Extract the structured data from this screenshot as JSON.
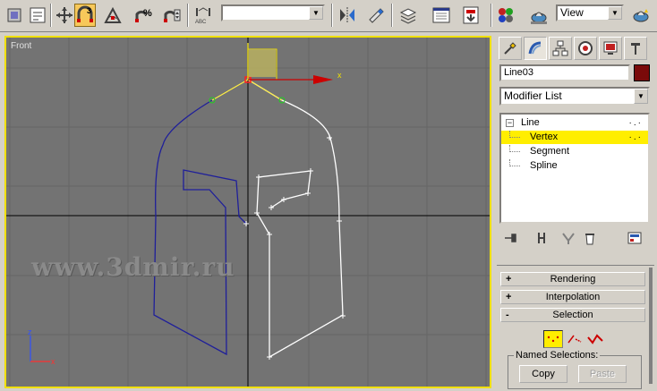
{
  "toolbar": {
    "named_selection_value": "",
    "view_dropdown_value": "View",
    "snap_label": "3",
    "angle_snap_label": "%",
    "mirror_label": "ABC"
  },
  "viewport": {
    "label": "Front",
    "axis_x_label": "x",
    "gizmo_x_label": "x",
    "gizmo_z_label": "z",
    "watermark": "www.3dmir.ru",
    "border_color": "#f0e000",
    "background_color": "#737373"
  },
  "panel": {
    "object_name": "Line03",
    "object_color": "#7a0a0a",
    "modifier_list_label": "Modifier List",
    "stack": [
      {
        "label": "Line",
        "type": "base"
      },
      {
        "label": "Vertex",
        "type": "sub",
        "selected": true
      },
      {
        "label": "Segment",
        "type": "sub"
      },
      {
        "label": "Spline",
        "type": "sub"
      }
    ],
    "rollouts": [
      {
        "sign": "+",
        "label": "Rendering"
      },
      {
        "sign": "+",
        "label": "Interpolation"
      },
      {
        "sign": "-",
        "label": "Selection"
      }
    ],
    "named_selections": {
      "label": "Named Selections:",
      "copy_label": "Copy",
      "paste_label": "Paste"
    }
  },
  "icons": {
    "toolbar": [
      "undo-icon",
      "redo-icon",
      "link-icon",
      "select-move-icon",
      "snap-3d-icon",
      "angle-snap-icon",
      "percent-snap-icon",
      "spinner-snap-icon",
      "mirror-icon",
      "align-icon",
      "layers-icon",
      "curve-editor-icon",
      "schematic-icon",
      "material-editor-icon",
      "render-scene-icon",
      "quick-render-icon"
    ],
    "panel_tabs": [
      "create-icon",
      "modify-icon",
      "hierarchy-icon",
      "motion-icon",
      "display-icon",
      "utilities-icon"
    ]
  }
}
